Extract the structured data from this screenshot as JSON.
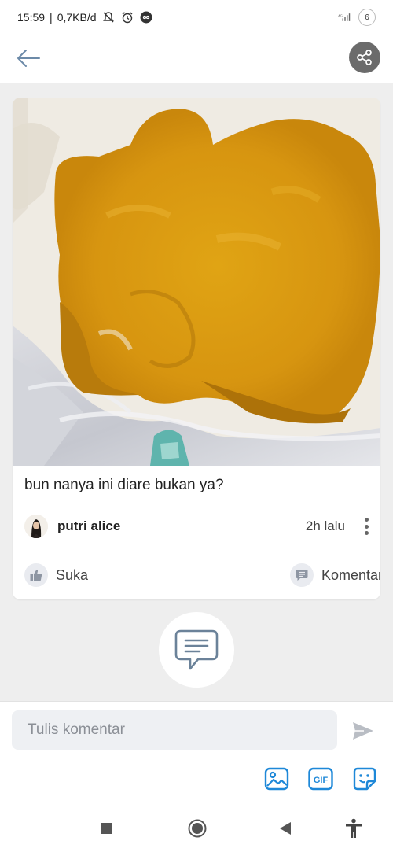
{
  "status_bar": {
    "time": "15:59",
    "speed": "0,7KB/d",
    "battery": "6",
    "icons": [
      "mute-icon",
      "alarm-icon",
      "infinity-icon",
      "signal-icon",
      "battery-icon"
    ]
  },
  "app_bar": {
    "back_icon": "arrow-left-icon",
    "share_icon": "share-icon"
  },
  "post": {
    "image": "diaper-photo",
    "text": "bun nanya ini diare bukan ya?",
    "author": "putri alice",
    "time": "2h lalu",
    "like_label": "Suka",
    "comment_label": "Komentar"
  },
  "composer": {
    "placeholder": "Tulis komentar",
    "value": "",
    "tools": [
      "image-icon",
      "gif-icon",
      "sticker-icon"
    ],
    "gif_label": "GIF",
    "send_icon": "send-icon"
  },
  "nav": [
    "recents-icon",
    "home-icon",
    "back-icon",
    "accessibility-icon"
  ],
  "colors": {
    "accent": "#1e88d8",
    "icon_gray": "#666666",
    "share_bg": "#6b6b6b",
    "background": "#eeeeee"
  }
}
